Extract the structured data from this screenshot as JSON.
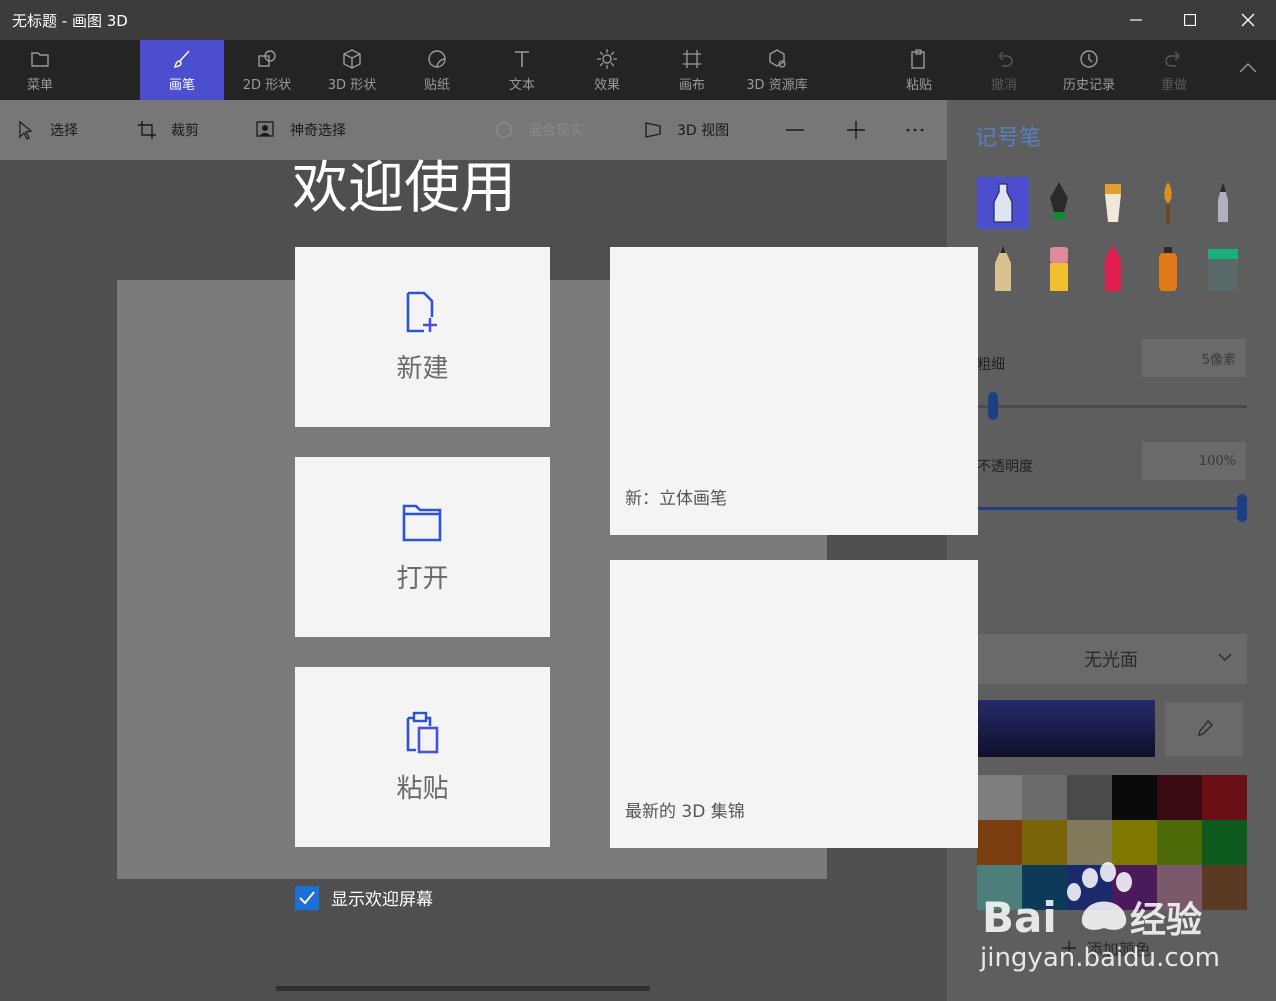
{
  "window": {
    "title": "无标题 - 画图 3D",
    "controls": [
      "minimize",
      "maximize",
      "close"
    ]
  },
  "ribbon": {
    "menu": "菜单",
    "brushes": "画笔",
    "shapes2d": "2D 形状",
    "shapes3d": "3D 形状",
    "stickers": "贴纸",
    "text": "文本",
    "effects": "效果",
    "canvas": "画布",
    "library3d": "3D 资源库",
    "paste": "粘贴",
    "undo": "撤消",
    "history": "历史记录",
    "redo": "重做",
    "active": "画笔"
  },
  "toolbar": {
    "select": "选择",
    "crop": "裁剪",
    "magic_select": "神奇选择",
    "mixed_reality": "混合现实",
    "view3d": "3D 视图"
  },
  "panel": {
    "title": "记号笔",
    "thickness_label": "粗细",
    "thickness_value": "5像素",
    "thickness_level": 0.05,
    "opacity_label": "不透明度",
    "opacity_value": "100%",
    "opacity_level": 1.0,
    "finish": "无光面",
    "add_color": "添加颜色",
    "palette": [
      "#7e7e7e",
      "#6b6b6b",
      "#4a4a4a",
      "#0a0a0a",
      "#3a0a12",
      "#6a1014",
      "#7a3e10",
      "#7a6408",
      "#807a5a",
      "#7e7800",
      "#4c6a08",
      "#0e5a1e",
      "#4e7e7a",
      "#0e3a5a",
      "#1a2a6a",
      "#4a1a5a",
      "#7a5a6a",
      "#5a3a22"
    ],
    "current_color": "#262a6a"
  },
  "welcome": {
    "title": "欢迎使用",
    "new_label": "新建",
    "open_label": "打开",
    "paste_label": "粘贴",
    "feature1": "新：立体画笔",
    "feature2": "最新的 3D 集锦",
    "show_welcome": "显示欢迎屏幕",
    "show_welcome_checked": true
  },
  "watermark": {
    "brand": "Bai du 经验",
    "url": "jingyan.baidu.com"
  }
}
